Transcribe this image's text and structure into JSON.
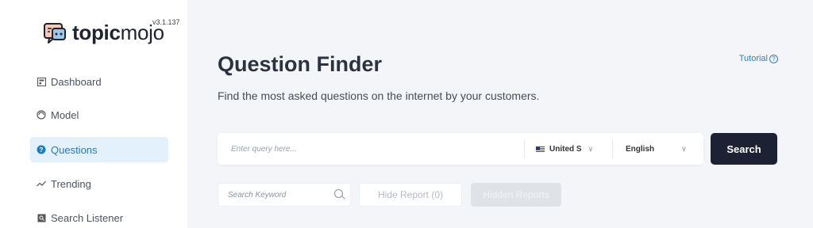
{
  "app": {
    "logo_bold": "topic",
    "logo_rest": "mojo",
    "version": "v3.1.137"
  },
  "sidebar": {
    "items": [
      {
        "label": "Dashboard",
        "icon": "dashboard-icon",
        "active": false
      },
      {
        "label": "Model",
        "icon": "model-icon",
        "active": false
      },
      {
        "label": "Questions",
        "icon": "question-icon",
        "active": true
      },
      {
        "label": "Trending",
        "icon": "trending-icon",
        "active": false
      },
      {
        "label": "Search Listener",
        "icon": "search-listener-icon",
        "active": false
      }
    ]
  },
  "header": {
    "title": "Question Finder",
    "subtitle": "Find the most asked questions on the internet by your customers.",
    "tutorial_label": "Tutorial"
  },
  "search": {
    "placeholder": "Enter query here...",
    "country": "United S",
    "language": "English",
    "button_label": "Search"
  },
  "filters": {
    "keyword_placeholder": "Search Keyword",
    "hide_report_label": "Hide Report (0)",
    "hidden_reports_label": "Hidden Reports"
  },
  "colors": {
    "accent": "#1d7bc4",
    "active_bg": "#e3f1fc",
    "search_button": "#1c2233",
    "background": "#f3f5f8"
  }
}
